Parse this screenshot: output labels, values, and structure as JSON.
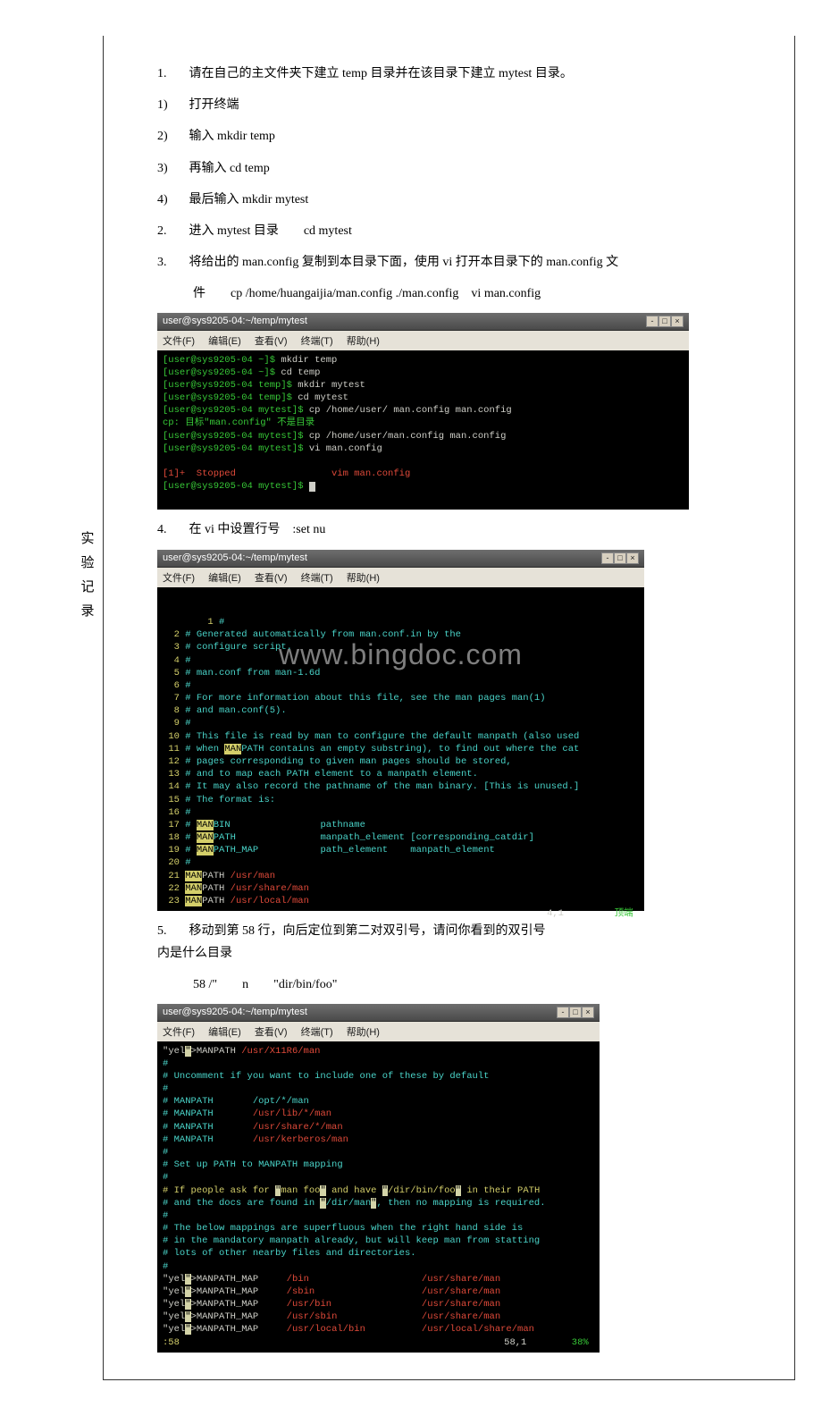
{
  "side_label": [
    "实",
    "验",
    "记",
    "录"
  ],
  "steps": {
    "s1": {
      "num": "1.",
      "text": "请在自己的主文件夹下建立 temp 目录并在该目录下建立 mytest 目录。"
    },
    "s1a": {
      "num": "1)",
      "text": "打开终端"
    },
    "s1b": {
      "num": "2)",
      "text": "输入 mkdir temp"
    },
    "s1c": {
      "num": "3)",
      "text": "再输入 cd temp"
    },
    "s1d": {
      "num": "4)",
      "text": "最后输入 mkdir mytest"
    },
    "s2": {
      "num": "2.",
      "text": "进入 mytest 目录　　cd mytest"
    },
    "s3": {
      "num": "3.",
      "text": "将给出的 man.config 复制到本目录下面，使用 vi 打开本目录下的 man.config 文"
    },
    "s3b": "件　　cp /home/huangaijia/man.config ./man.config　vi man.config",
    "s4": {
      "num": "4.",
      "text": "在 vi 中设置行号　:set nu"
    },
    "s5": {
      "num": "5.",
      "text": "移动到第 58 行，向后定位到第二对双引号，请问你看到的双引号内是什么目录"
    },
    "s5b": "58 /\"　　n　　\"dir/bin/foo\""
  },
  "term1": {
    "title": "user@sys9205-04:~/temp/mytest",
    "menu": [
      "文件(F)",
      "编辑(E)",
      "查看(V)",
      "终端(T)",
      "帮助(H)"
    ],
    "lines": [
      {
        "p": "[user@sys9205-04 ~]$ ",
        "c": "mkdir temp"
      },
      {
        "p": "[user@sys9205-04 ~]$ ",
        "c": "cd temp"
      },
      {
        "p": "[user@sys9205-04 temp]$ ",
        "c": "mkdir mytest"
      },
      {
        "p": "[user@sys9205-04 temp]$ ",
        "c": "cd mytest"
      },
      {
        "p": "[user@sys9205-04 mytest]$ ",
        "c": "cp /home/user/ man.config man.config"
      },
      {
        "err": "cp: 目标\"man.config\" 不是目录"
      },
      {
        "p": "[user@sys9205-04 mytest]$ ",
        "c": "cp /home/user/man.config man.config"
      },
      {
        "p": "[user@sys9205-04 mytest]$ ",
        "c": "vi man.config"
      }
    ],
    "stopped": "[1]+  Stopped                 vim man.config",
    "prompt": "[user@sys9205-04 mytest]$ "
  },
  "term2": {
    "title": "user@sys9205-04:~/temp/mytest",
    "watermark": "www.bingdoc.com",
    "lines": [
      "  1 #",
      "  2 # Generated automatically from man.conf.in by the",
      "  3 # configure script.",
      "  4 #",
      "  5 # man.conf from man-1.6d",
      "  6 #",
      "  7 # For more information about this file, see the man pages man(1)",
      "  8 # and man.conf(5).",
      "  9 #",
      " 10 # This file is read by man to configure the default manpath (also used",
      " 11 # when MANPATH contains an empty substring), to find out where the cat",
      " 12 # pages corresponding to given man pages should be stored,",
      " 13 # and to map each PATH element to a manpath element.",
      " 14 # It may also record the pathname of the man binary. [This is unused.]",
      " 15 # The format is:",
      " 16 #",
      " 17 # MANBIN                pathname",
      " 18 # MANPATH               manpath_element [corresponding_catdir]",
      " 19 # MANPATH_MAP           path_element    manpath_element",
      " 20 #",
      " 21 MANPATH /usr/man",
      " 22 MANPATH /usr/share/man",
      " 23 MANPATH /usr/local/man"
    ],
    "status": {
      "pos": "4,1",
      "pct": "顶端"
    }
  },
  "term3": {
    "title": "user@sys9205-04:~/temp/mytest",
    "lines": [
      "MANPATH /usr/X11R6/man",
      "#",
      "# Uncomment if you want to include one of these by default",
      "#",
      "# MANPATH       /opt/*/man",
      "# MANPATH       /usr/lib/*/man",
      "# MANPATH       /usr/share/*/man",
      "# MANPATH       /usr/kerberos/man",
      "#",
      "# Set up PATH to MANPATH mapping",
      "#",
      "# If people ask for \"man foo\" and have \"/dir/bin/foo\" in their PATH",
      "# and the docs are found in \"/dir/man\", then no mapping is required.",
      "#",
      "# The below mappings are superfluous when the right hand side is",
      "# in the mandatory manpath already, but will keep man from statting",
      "# lots of other nearby files and directories.",
      "#",
      "MANPATH_MAP     /bin                    /usr/share/man",
      "MANPATH_MAP     /sbin                   /usr/share/man",
      "MANPATH_MAP     /usr/bin                /usr/share/man",
      "MANPATH_MAP     /usr/sbin               /usr/share/man",
      "MANPATH_MAP     /usr/local/bin          /usr/local/share/man"
    ],
    "cmd": ":58",
    "status": {
      "pos": "58,1",
      "pct": "38%"
    }
  }
}
